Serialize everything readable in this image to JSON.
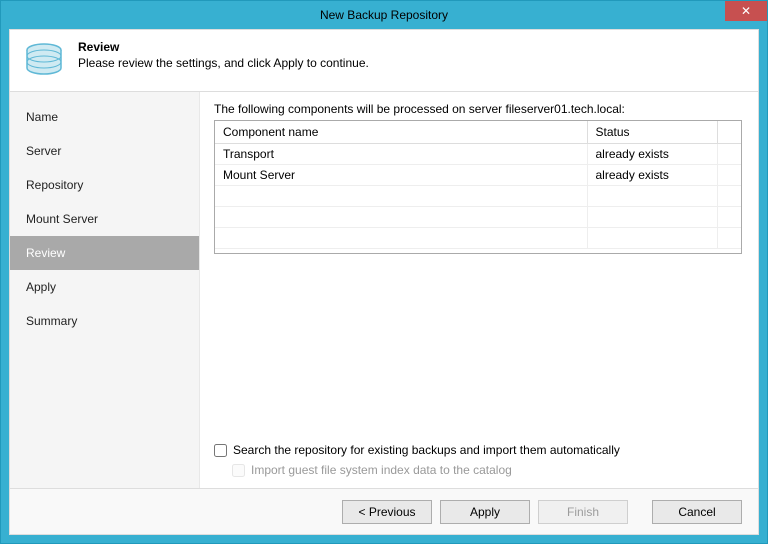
{
  "window": {
    "title": "New Backup Repository"
  },
  "header": {
    "title": "Review",
    "description": "Please review the settings, and click Apply to continue."
  },
  "sidebar": {
    "items": [
      {
        "label": "Name"
      },
      {
        "label": "Server"
      },
      {
        "label": "Repository"
      },
      {
        "label": "Mount Server"
      },
      {
        "label": "Review"
      },
      {
        "label": "Apply"
      },
      {
        "label": "Summary"
      }
    ],
    "active_index": 4
  },
  "main": {
    "intro": "The following components will be processed on server fileserver01.tech.local:",
    "columns": {
      "component": "Component name",
      "status": "Status"
    },
    "rows": [
      {
        "component": "Transport",
        "status": "already exists"
      },
      {
        "component": "Mount Server",
        "status": "already exists"
      }
    ],
    "checkbox1": "Search the repository for existing backups and import them automatically",
    "checkbox2": "Import guest file system index data to the catalog"
  },
  "buttons": {
    "previous": "< Previous",
    "apply": "Apply",
    "finish": "Finish",
    "cancel": "Cancel"
  }
}
